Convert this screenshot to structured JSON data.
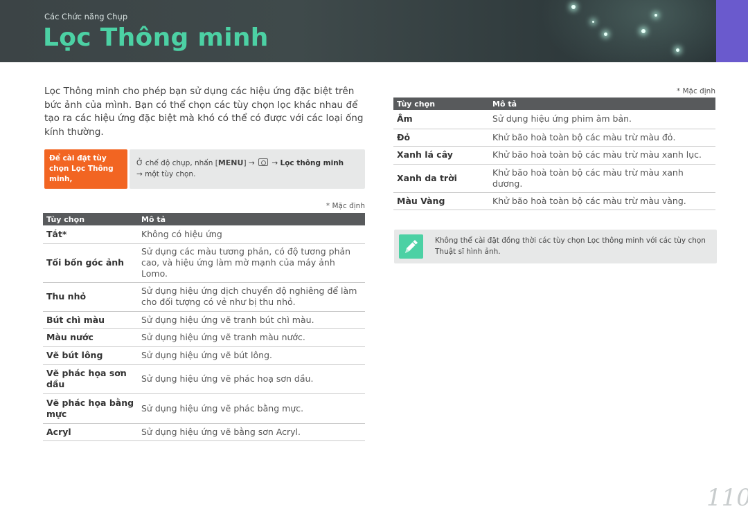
{
  "header": {
    "section": "Các Chức năng Chụp",
    "title": "Lọc Thông minh"
  },
  "intro": "Lọc Thông minh cho phép bạn sử dụng các hiệu ứng đặc biệt trên bức ảnh của mình. Bạn có thể chọn các tùy chọn lọc khác nhau để tạo ra các hiệu ứng đặc biệt mà khó có thể có được với các loại ống kính thường.",
  "howto": {
    "label": "Để cài đặt tùy chọn Lọc Thông minh,",
    "prefix": "Ở chế độ chụp, nhấn [",
    "menu_key": "MENU",
    "middle": "] → ",
    "arrow2": " → ",
    "option": "Lọc thông minh",
    "line2": "→ một tùy chọn."
  },
  "left_table": {
    "default_note": "* Mặc định",
    "headers": [
      "Tùy chọn",
      "Mô tả"
    ],
    "rows": [
      {
        "name": "Tắt*",
        "desc": "Không có hiệu ứng"
      },
      {
        "name": "Tối bốn góc ảnh",
        "desc": "Sử dụng các màu tương phản, có độ tương phản cao, và hiệu ứng làm mờ mạnh của máy ảnh Lomo."
      },
      {
        "name": "Thu nhỏ",
        "desc": "Sử dụng hiệu ứng dịch chuyển độ nghiêng để làm cho đối tượng có vẻ như bị thu nhỏ."
      },
      {
        "name": "Bút chì màu",
        "desc": "Sử dụng hiệu ứng vẽ tranh bút chì màu."
      },
      {
        "name": "Màu nước",
        "desc": "Sử dụng hiệu ứng vẽ tranh màu nước."
      },
      {
        "name": "Vẽ bút lông",
        "desc": "Sử dụng hiệu ứng vẽ bút lông."
      },
      {
        "name": "Vẽ phác họa sơn dầu",
        "desc": "Sử dụng hiệu ứng vẽ phác hoạ sơn dầu."
      },
      {
        "name": "Vẽ phác họa bằng mực",
        "desc": "Sử dụng hiệu ứng vẽ phác bằng mực."
      },
      {
        "name": "Acryl",
        "desc": "Sử dụng hiệu ứng vẽ bằng sơn Acryl."
      }
    ]
  },
  "right_table": {
    "default_note": "* Mặc định",
    "headers": [
      "Tùy chọn",
      "Mô tả"
    ],
    "rows": [
      {
        "name": "Âm",
        "desc": "Sử dụng hiệu ứng phim âm bản."
      },
      {
        "name": "Đỏ",
        "desc": "Khử bão hoà toàn bộ các màu trừ màu đỏ."
      },
      {
        "name": "Xanh lá cây",
        "desc": "Khử bão hoà toàn bộ các màu trừ màu xanh lục."
      },
      {
        "name": "Xanh da trời",
        "desc": "Khử bão hoà toàn bộ các màu trừ màu xanh dương."
      },
      {
        "name": "Màu Vàng",
        "desc": "Khử bão hoà toàn bộ các màu trừ màu vàng."
      }
    ]
  },
  "tip": {
    "icon": "pencil-note-icon",
    "text": "Không thể cài đặt đồng thời các tùy chọn Lọc thông minh với các tùy chọn Thuật sĩ hình ảnh."
  },
  "page_number": "110",
  "colors": {
    "title_green": "#4cd1a4",
    "howto_orange": "#f26522",
    "header_purple": "#6a5acd",
    "table_header": "#585a5c"
  }
}
